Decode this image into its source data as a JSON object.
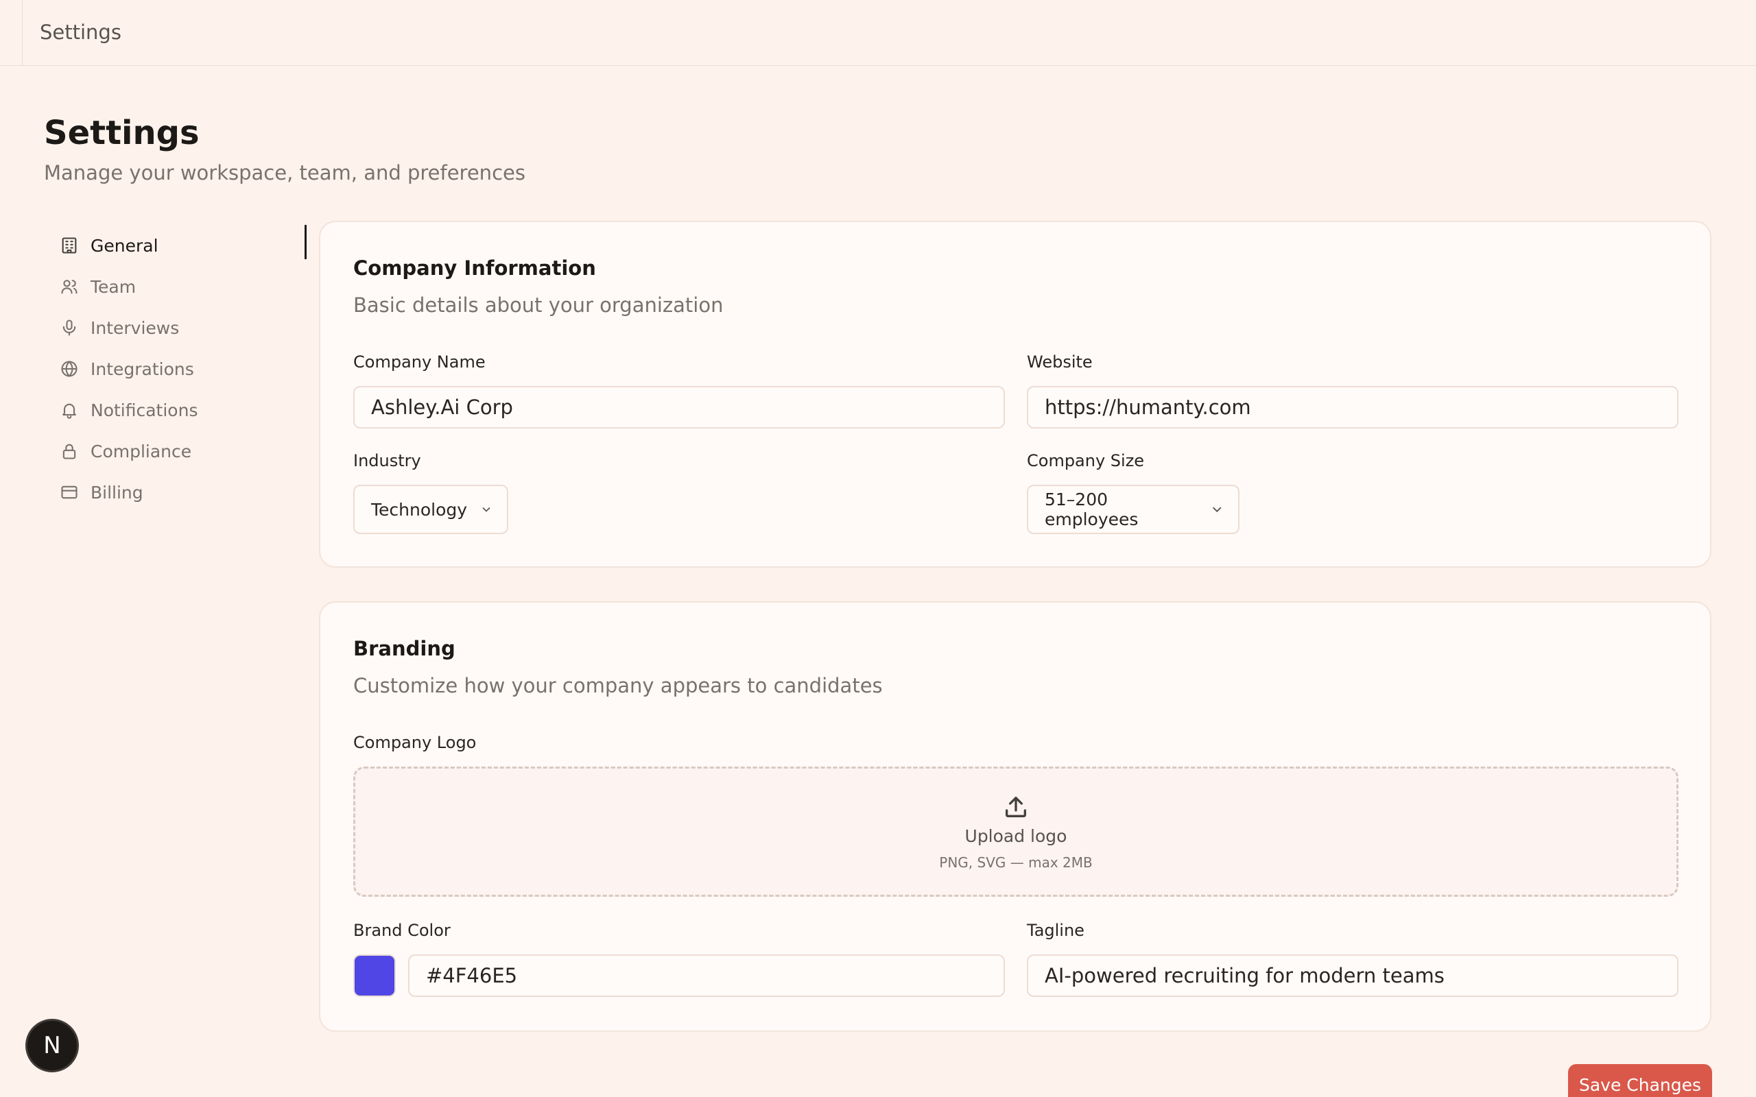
{
  "header": {
    "breadcrumb": "Settings"
  },
  "page": {
    "title": "Settings",
    "subtitle": "Manage your workspace, team, and preferences"
  },
  "nav": {
    "items": [
      {
        "label": "General",
        "icon": "building-icon",
        "active": true
      },
      {
        "label": "Team",
        "icon": "users-icon"
      },
      {
        "label": "Interviews",
        "icon": "microphone-icon"
      },
      {
        "label": "Integrations",
        "icon": "globe-icon"
      },
      {
        "label": "Notifications",
        "icon": "bell-icon"
      },
      {
        "label": "Compliance",
        "icon": "lock-icon"
      },
      {
        "label": "Billing",
        "icon": "credit-card-icon"
      }
    ]
  },
  "company": {
    "title": "Company Information",
    "subtitle": "Basic details about your organization",
    "name_label": "Company Name",
    "name_value": "Ashley.Ai Corp",
    "website_label": "Website",
    "website_value": "https://humanty.com",
    "industry_label": "Industry",
    "industry_value": "Technology",
    "size_label": "Company Size",
    "size_value": "51–200 employees"
  },
  "branding": {
    "title": "Branding",
    "subtitle": "Customize how your company appears to candidates",
    "logo_label": "Company Logo",
    "upload_title": "Upload logo",
    "upload_hint": "PNG, SVG — max 2MB",
    "color_label": "Brand Color",
    "color_value": "#4F46E5",
    "tagline_label": "Tagline",
    "tagline_value": "AI-powered recruiting for modern teams"
  },
  "actions": {
    "save_label": "Save Changes"
  },
  "avatar": {
    "initial": "N"
  },
  "colors": {
    "background": "#fdf2ec",
    "brand_swatch": "#4F46E5",
    "save_button": "#d9584a"
  }
}
